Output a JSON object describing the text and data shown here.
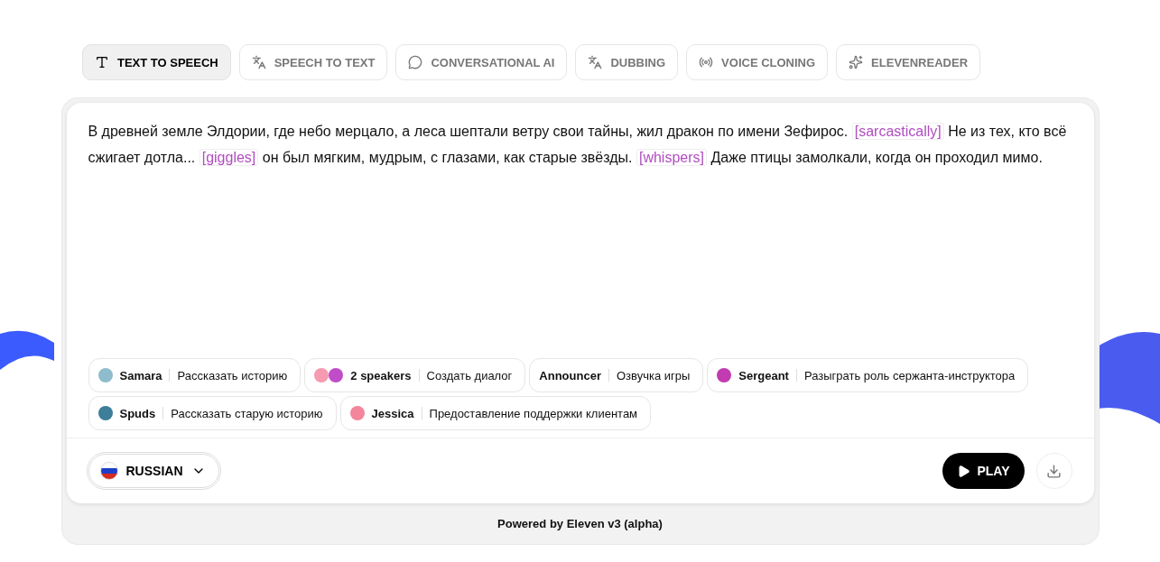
{
  "tabs": [
    {
      "label": "TEXT TO SPEECH",
      "kind": "tts",
      "selected": true
    },
    {
      "label": "SPEECH TO TEXT",
      "kind": "stt",
      "selected": false
    },
    {
      "label": "CONVERSATIONAL AI",
      "kind": "conv",
      "selected": false
    },
    {
      "label": "DUBBING",
      "kind": "dub",
      "selected": false
    },
    {
      "label": "VOICE CLONING",
      "kind": "clone",
      "selected": false
    },
    {
      "label": "ELEVENREADER",
      "kind": "reader",
      "selected": false
    }
  ],
  "editor": {
    "segments": [
      {
        "kind": "text",
        "text": "В древней земле Элдории, где небо мерцало, а леса шептали ветру свои тайны, жил дракон по имени Зефирос. "
      },
      {
        "kind": "tag",
        "text": "[sarcastically]"
      },
      {
        "kind": "text",
        "text": " Не из тех, кто всё сжигает дотла... "
      },
      {
        "kind": "tag",
        "text": "[giggles]"
      },
      {
        "kind": "text",
        "text": " он был мягким, мудрым, с глазами, как старые звёзды. "
      },
      {
        "kind": "tag",
        "text": "[whispers]"
      },
      {
        "kind": "text",
        "text": " Даже птицы замолкали, когда он проходил мимо."
      }
    ]
  },
  "voices": [
    {
      "name": "Samara",
      "prompt": "Рассказать историю",
      "avatars": [
        {
          "color": "#8fbccc"
        }
      ]
    },
    {
      "name": "2 speakers",
      "prompt": "Создать диалог",
      "avatars": [
        {
          "color": "#f59ab0"
        },
        {
          "color": "#c04cc8"
        }
      ]
    },
    {
      "name": "Announcer",
      "prompt": "Озвучка игры"
    },
    {
      "name": "Sergeant",
      "prompt": "Разыграть роль сержанта-инструктора",
      "avatars": [
        {
          "color": "#c23bb0"
        }
      ]
    },
    {
      "name": "Spuds",
      "prompt": "Рассказать старую историю",
      "avatars": [
        {
          "color": "#3d7e9a"
        }
      ]
    },
    {
      "name": "Jessica",
      "prompt": "Предоставление поддержки клиентам",
      "avatars": [
        {
          "color": "#f3869a"
        }
      ]
    }
  ],
  "language": {
    "label": "RUSSIAN"
  },
  "play_button": {
    "label": "PLAY"
  },
  "footer": "Powered by Eleven v3 (alpha)"
}
